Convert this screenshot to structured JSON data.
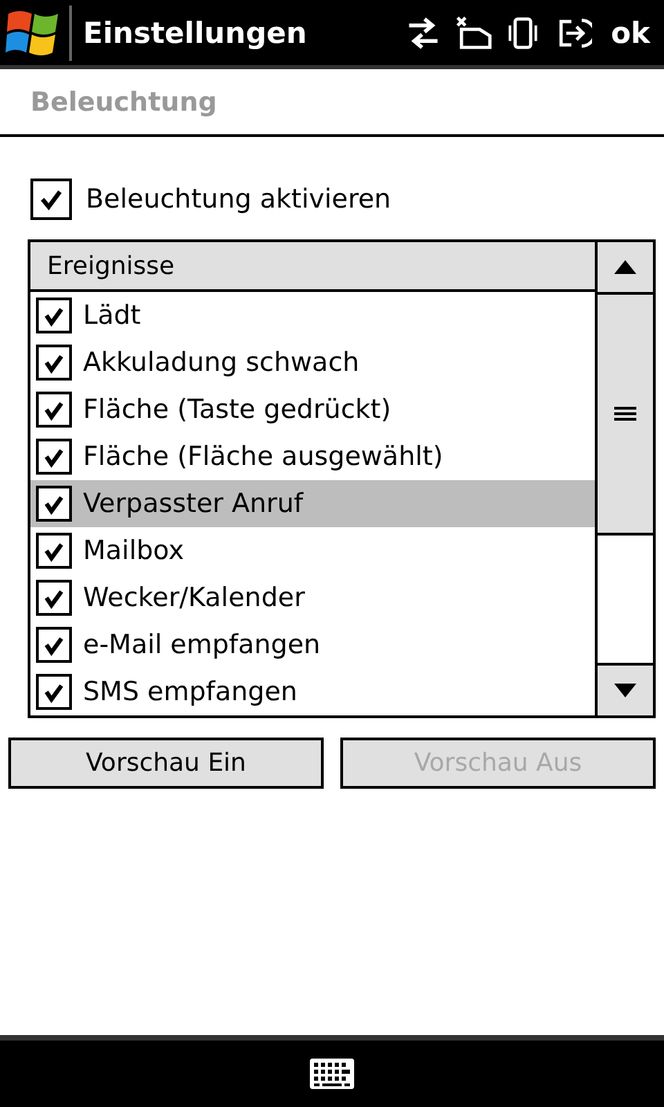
{
  "title_bar": {
    "title": "Einstellungen",
    "ok": "ok"
  },
  "page_title": "Beleuchtung",
  "enable": {
    "label": "Beleuchtung aktivieren",
    "checked": true
  },
  "list": {
    "header": "Ereignisse",
    "items": [
      {
        "label": "Lädt",
        "checked": true,
        "selected": false
      },
      {
        "label": "Akkuladung schwach",
        "checked": true,
        "selected": false
      },
      {
        "label": "Fläche (Taste gedrückt)",
        "checked": true,
        "selected": false
      },
      {
        "label": "Fläche (Fläche ausgewählt)",
        "checked": true,
        "selected": false
      },
      {
        "label": "Verpasster Anruf",
        "checked": true,
        "selected": true
      },
      {
        "label": "Mailbox",
        "checked": true,
        "selected": false
      },
      {
        "label": "Wecker/Kalender",
        "checked": true,
        "selected": false
      },
      {
        "label": "e-Mail empfangen",
        "checked": true,
        "selected": false
      },
      {
        "label": "SMS empfangen",
        "checked": true,
        "selected": false
      }
    ]
  },
  "buttons": [
    {
      "label": "Vorschau Ein",
      "disabled": false
    },
    {
      "label": "Vorschau Aus",
      "disabled": true
    }
  ]
}
